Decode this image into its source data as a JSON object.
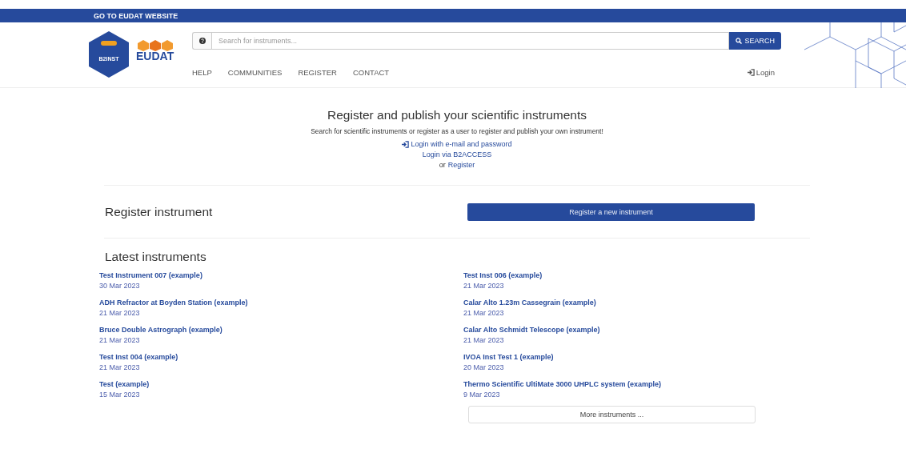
{
  "top_bar": {
    "link": "GO TO EUDAT WEBSITE"
  },
  "header": {
    "logo_text": "B2INST",
    "brand": "EUDAT",
    "search": {
      "placeholder": "Search for instruments...",
      "button": "SEARCH"
    },
    "nav": [
      "HELP",
      "COMMUNITIES",
      "REGISTER",
      "CONTACT"
    ],
    "login": "Login"
  },
  "hero": {
    "title": "Register and publish your scientific instruments",
    "subtitle": "Search for scientific instruments or register as a user to register and publish your own instrument!",
    "login_email": "Login with e-mail and password",
    "login_b2access": "Login via B2ACCESS",
    "or": "or",
    "register": "Register"
  },
  "register_section": {
    "title": "Register instrument",
    "button": "Register a new instrument"
  },
  "latest": {
    "title": "Latest instruments",
    "items": [
      {
        "name": "Test Instrument 007 (example)",
        "date": "30 Mar 2023"
      },
      {
        "name": "Test Inst 006 (example)",
        "date": "21 Mar 2023"
      },
      {
        "name": "ADH Refractor at Boyden Station (example)",
        "date": "21 Mar 2023"
      },
      {
        "name": "Calar Alto 1.23m Cassegrain (example)",
        "date": "21 Mar 2023"
      },
      {
        "name": "Bruce Double Astrograph (example)",
        "date": "21 Mar 2023"
      },
      {
        "name": "Calar Alto Schmidt Telescope (example)",
        "date": "21 Mar 2023"
      },
      {
        "name": "Test Inst 004 (example)",
        "date": "21 Mar 2023"
      },
      {
        "name": "IVOA Inst Test 1 (example)",
        "date": "20 Mar 2023"
      },
      {
        "name": "Test (example)",
        "date": "15 Mar 2023"
      },
      {
        "name": "Thermo Scientific UltiMate 3000 UHPLC system (example)",
        "date": "9 Mar 2023"
      }
    ],
    "more_button": "More instruments ..."
  }
}
